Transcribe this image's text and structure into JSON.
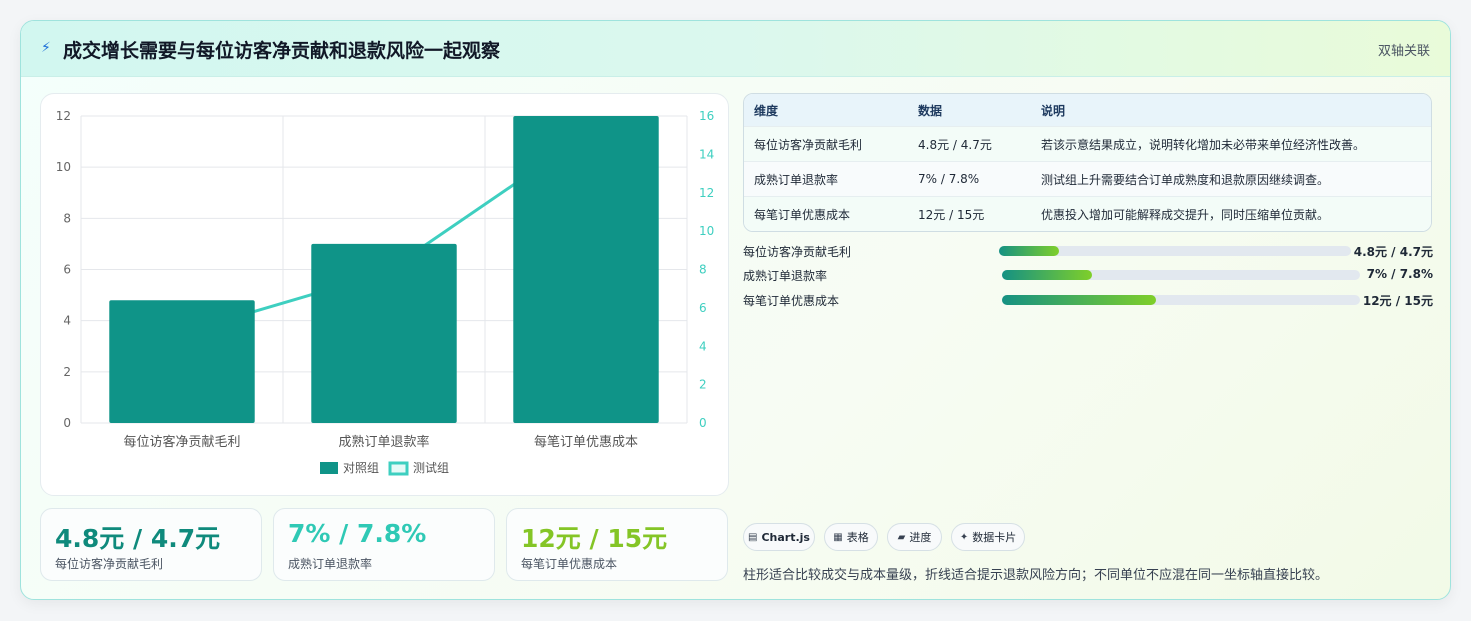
{
  "header": {
    "icon": "lightning-icon",
    "title": "成交增长需要与每位访客净贡献和退款风险一起观察",
    "tag": "双轴关联"
  },
  "chart_data": {
    "type": "bar",
    "categories": [
      "每位访客净贡献毛利",
      "成熟订单退款率",
      "每笔订单优惠成本"
    ],
    "series": [
      {
        "name": "对照组",
        "type": "bar",
        "axis": "left",
        "color": "#0f9488",
        "values": [
          4.8,
          7,
          12
        ]
      },
      {
        "name": "测试组",
        "type": "line",
        "axis": "right",
        "color": "#3ecfc0",
        "values": [
          4.7,
          7.8,
          15
        ]
      }
    ],
    "y_left": {
      "min": 0,
      "max": 12,
      "ticks": [
        0,
        2,
        4,
        6,
        8,
        10,
        12
      ]
    },
    "y_right": {
      "min": 0,
      "max": 16,
      "ticks": [
        0,
        2,
        4,
        6,
        8,
        10,
        12,
        14,
        16
      ]
    },
    "legend_position": "bottom",
    "grid": true
  },
  "kpis": [
    {
      "value": "4.8元 / 4.7元",
      "label": "每位访客净贡献毛利",
      "color": "#0f8a7c"
    },
    {
      "value": "7% / 7.8%",
      "label": "成熟订单退款率",
      "color": "#2fc9b5"
    },
    {
      "value": "12元 / 15元",
      "label": "每笔订单优惠成本",
      "color": "#84c526"
    }
  ],
  "table": {
    "headers": [
      "维度",
      "数据",
      "说明"
    ],
    "rows": [
      [
        "每位访客净贡献毛利",
        "4.8元 / 4.7元",
        "若该示意结果成立，说明转化增加未必带来单位经济性改善。"
      ],
      [
        "成熟订单退款率",
        "7% / 7.8%",
        "测试组上升需要结合订单成熟度和退款原因继续调查。"
      ],
      [
        "每笔订单优惠成本",
        "12元 / 15元",
        "优惠投入增加可能解释成交提升，同时压缩单位贡献。"
      ]
    ]
  },
  "progress": [
    {
      "label": "每位访客净贡献毛利",
      "value": "4.8元 / 4.7元",
      "fill": 0.17
    },
    {
      "label": "成熟订单退款率",
      "value": "7% / 7.8%",
      "fill": 0.25
    },
    {
      "label": "每笔订单优惠成本",
      "value": "12元 / 15元",
      "fill": 0.43
    }
  ],
  "chips": [
    {
      "icon": "chart-icon",
      "label": "Chart.js"
    },
    {
      "icon": "table-icon",
      "label": "表格"
    },
    {
      "icon": "progress-icon",
      "label": "进度"
    },
    {
      "icon": "card-icon",
      "label": "数据卡片"
    }
  ],
  "note": "柱形适合比较成交与成本量级，折线适合提示退款风险方向；不同单位不应混在同一坐标轴直接比较。"
}
